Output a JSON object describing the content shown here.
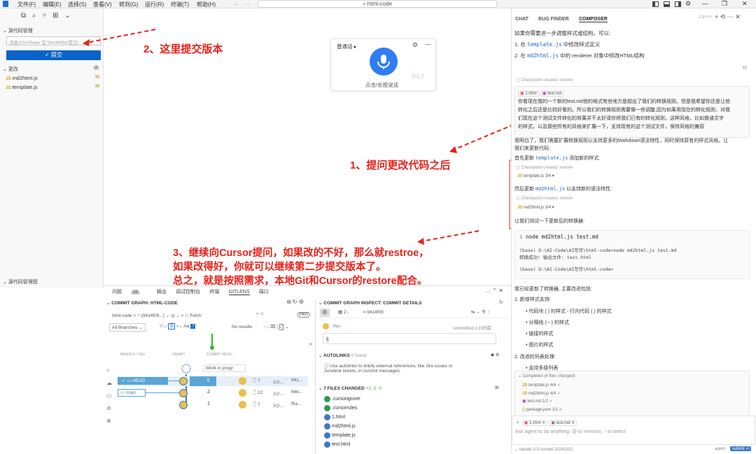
{
  "menu": [
    "文件(F)",
    "编辑(E)",
    "选择(S)",
    "查看(V)",
    "转到(G)",
    "运行(R)",
    "终端(T)",
    "帮助(H)"
  ],
  "search_label": "html-code",
  "sidebar": {
    "section_title": "源代码管理",
    "commit_placeholder": "消息(Ctrl+Enter 在\"9414f09d\"提交)",
    "commit_button": "✓ 提交",
    "changes_label": "更改",
    "changes_count": "2",
    "files": [
      {
        "name": "md2html.js",
        "status": "M"
      },
      {
        "name": "template.js",
        "status": "M"
      }
    ],
    "bottom_section": "源代码管理图"
  },
  "annotations": {
    "step2": "2、这里提交版本",
    "step1": "1、提问更改代码之后",
    "step3_line1": "3、继续向Cursor提问，如果改的不好，那么就restroe，",
    "step3_line2": "如果改得好，你就可以继续第二步提交版本了。",
    "step3_line3": "总之，就是按照需求，本地Git和Cursor的restore配合。"
  },
  "voice": {
    "mode": "普通话",
    "hint": "点击/长按说话",
    "brand": "iFLY"
  },
  "panel_tabs": [
    "问题",
    "输出",
    "调试控制台",
    "终端",
    "GITLENS",
    "端口"
  ],
  "panel_problems_count": "33",
  "graph": {
    "title": "COMMIT GRAPH: HTML-CODE",
    "repo": "html-code",
    "branch_ref": "(9414f09...)",
    "fetch": "Fetch",
    "pro": "PRO",
    "all_branches": "All Branches",
    "no_results": "No results",
    "col_branch": "BRANCH / TAG",
    "col_graph": "GRAPH",
    "col_message": "COMMIT MESS...",
    "wip": "Work in progr",
    "rows": [
      {
        "branch": "HEAD",
        "msg": "lj",
        "files": "7",
        "time": "1小...",
        "sha": "941..."
      },
      {
        "branch": "main",
        "msg": "2",
        "files": "12",
        "time": "2小...",
        "sha": "66b..."
      },
      {
        "branch": "",
        "msg": "1",
        "files": "7",
        "time": "2小...",
        "sha": "f5a..."
      }
    ]
  },
  "inspect": {
    "title": "COMMIT GRAPH INSPECT: COMMIT DETAILS",
    "sha": "9414f09",
    "author": "You",
    "committed": "committed 1小时前",
    "message": "lj",
    "autolinks_title": "AUTOLINKS",
    "autolinks_found": "0 found",
    "autolinks_text1": "Use autolinks to linkify external references, like Jira issues or",
    "autolinks_text2": "Zendesk tickets, in commit messages.",
    "files_title": "7 FILES CHANGED",
    "files_stats": "+2  -5  -0",
    "files": [
      ".cursorignore",
      ".cursorrules",
      "1.html",
      "md2html.js",
      "template.js",
      "test.html"
    ]
  },
  "chat": {
    "tabs": [
      "CHAT",
      "BUG FINDER",
      "COMPOSER"
    ],
    "new_chat_hint": "Ctrl+N",
    "intro": "如果你需要进一步调整样式或结构，可以:",
    "list1_prefix": "1. 在 ",
    "list1_code": "template.js",
    "list1_suffix": " 中修改样式定义",
    "list2_prefix": "2. 在 ",
    "list2_code": "md2html.js",
    "list2_suffix": " 中的 renderer 对象中修改HTML结构",
    "checkpoint": "Checkpoint created. restore",
    "user_chips": [
      "1.html",
      "test.md"
    ],
    "user_msg": [
      "你看现在我的一个新的test.md他的格式有些地方是超出了我们的转换规则，但是我希望你还是让他",
      "转化之后还是比较好看的。所以我们的转换规则需要做一些调整,因为如果用现在的转化规则，对我",
      "们现在这个测试文件转化的效果并不太好请你将我们已有的转化规则，这种风格，比如普通文字",
      "的样式，以及那些所有的风格来扩展一下，支持现有的这个测试文件，保持风格的兼容"
    ],
    "reply1": "我明白了，我们需要扩展转换规则以支持更多的Markdown语法特性，同时保持原有的样式风格。让",
    "reply1b": "我们来更新代码:",
    "first_update_prefix": "首先更新 ",
    "first_update_code": "template.js",
    "first_update_suffix": " 添加新的样式:",
    "file_chip1": "template.js 3/4",
    "then_update_prefix": "然后更新 ",
    "then_update_code": "md2html.js",
    "then_update_suffix": " 以支持新的语法特性:",
    "file_chip2": "md2html.js 3/4",
    "test_line": "让我们测试一下更新后的转换器:",
    "cmd": "node md2html.js test.md",
    "term1": "(base) D:\\AI-Code\\AI写作\\html-code>node md2html.js test.md",
    "term2": "转换成功! 输出文件: test.html",
    "term3": "(base) D:\\AI-Code\\AI写作\\html-code>",
    "summary": "我已经更新了转换器, 主要改进包括:",
    "s1": "1. 新增样式支持:",
    "b1": "代码块 ( ) 的样式 - 行内代码 ( ) 的样式",
    "b2": "分隔线 (---) 的样式",
    "b3": "链接的样式",
    "b4": "图片的样式",
    "s2": "2. 改进的列表处理:",
    "b5": "支持多级列表",
    "completed": "Completed (4 files changed)",
    "completed_files": [
      "template.js 4/4 ✓",
      "md2html.js 4/4 ✓",
      "test.md 1/1 ✓",
      "package.json 1/1 ✓"
    ],
    "input_chips": [
      "1.html",
      "test.md"
    ],
    "input_placeholder": "Ask agent to do anything. @ to mention, ↑ to select",
    "model": "claude-3-5-sonnet-20241022",
    "agent": "agent",
    "submit": "submit ⏎"
  }
}
